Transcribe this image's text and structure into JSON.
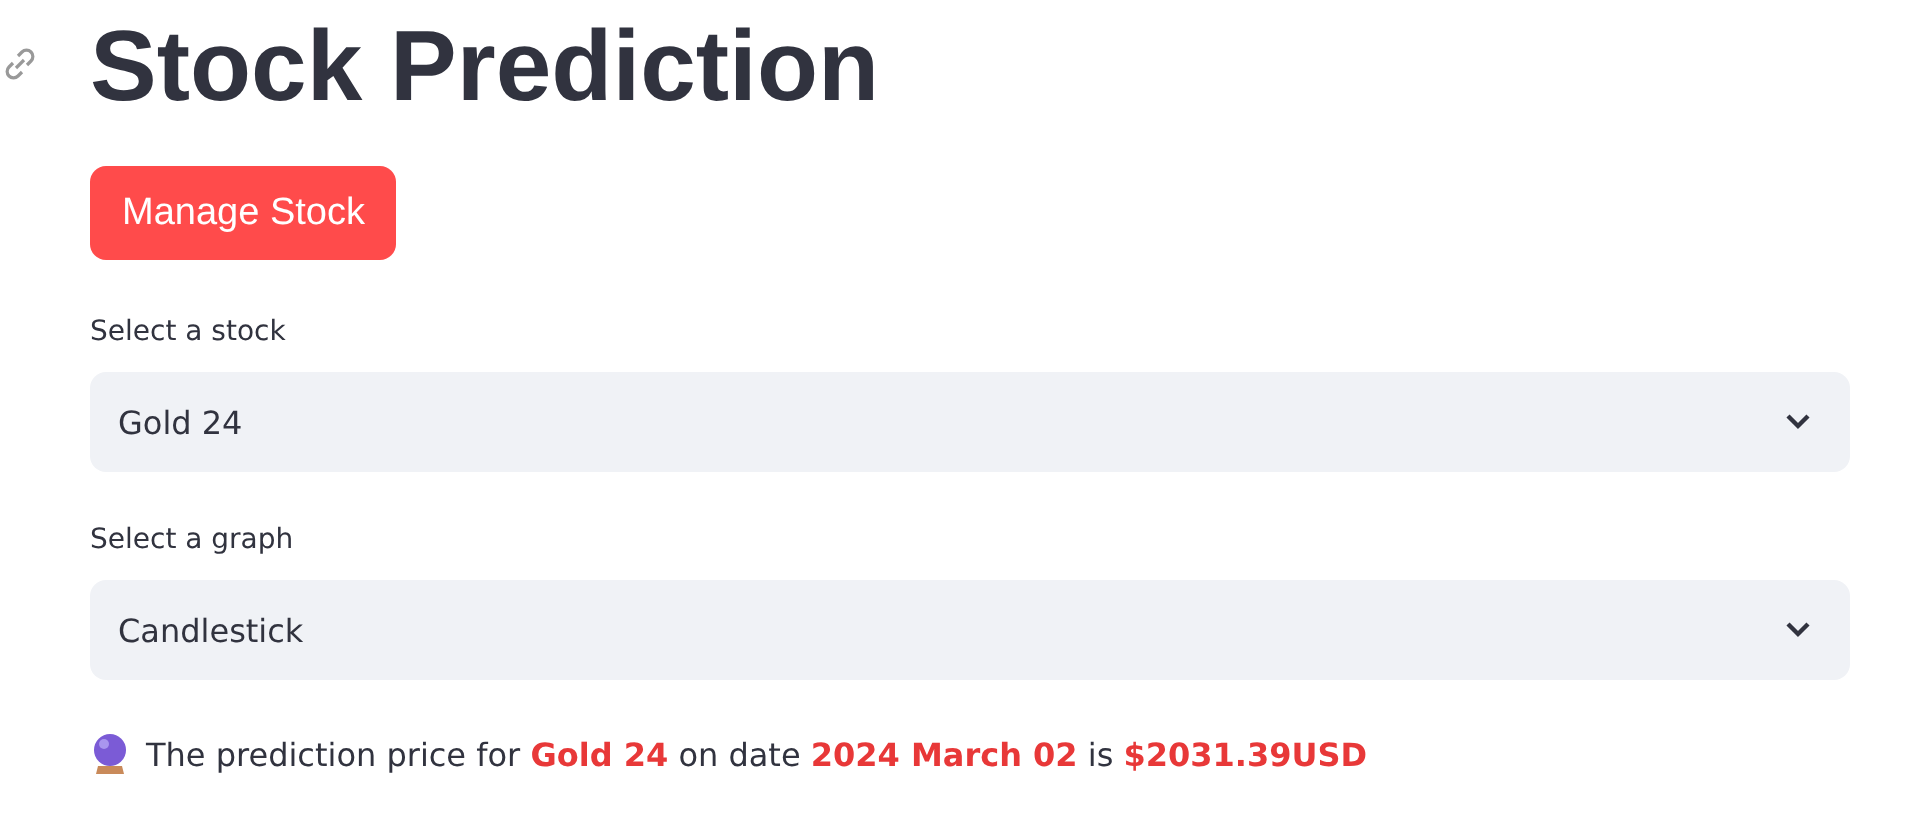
{
  "title": "Stock Prediction",
  "button": "Manage Stock",
  "selects": [
    {
      "label": "Select a stock",
      "value": "Gold 24"
    },
    {
      "label": "Select a graph",
      "value": "Candlestick"
    }
  ],
  "prediction": "The prediction price for **Gold 24** on date **2024 March 02** is **$2031.39USD**"
}
